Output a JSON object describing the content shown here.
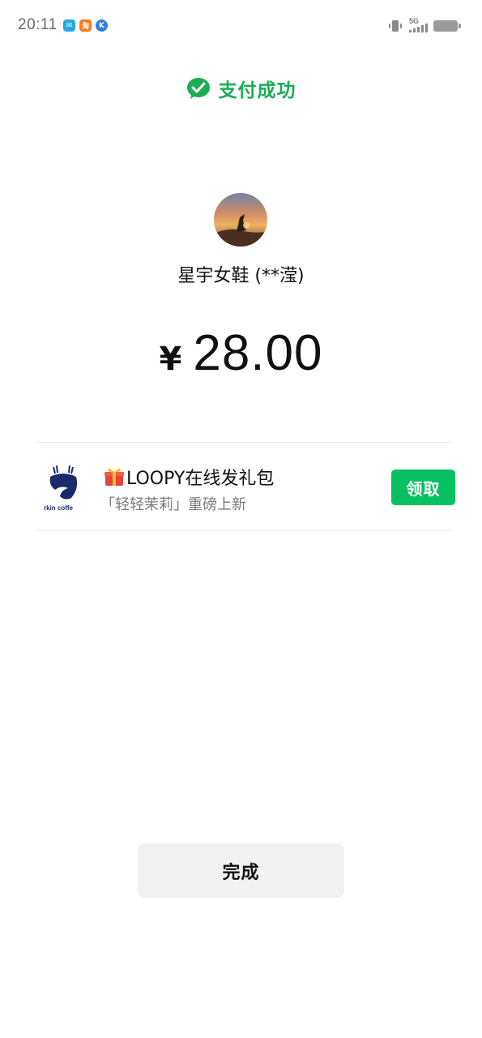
{
  "status_bar": {
    "time": "20:11",
    "network": "5G",
    "notifications": [
      {
        "icon": "message-app-icon",
        "glyph": "✉"
      },
      {
        "icon": "taobao-app-icon",
        "glyph": "淘"
      },
      {
        "icon": "k-app-icon",
        "glyph": "K"
      }
    ]
  },
  "header": {
    "success_text": "支付成功",
    "accent_color": "#1aad52"
  },
  "merchant": {
    "name": "星宇女鞋 (**滢)"
  },
  "payment": {
    "currency_symbol": "¥",
    "amount": "28.00"
  },
  "promo": {
    "title": "LOOPY在线发礼包",
    "subtitle": "「轻轻茉莉」重磅上新",
    "logo_text": "rkin coffe",
    "claim_label": "领取",
    "claim_color": "#07c160"
  },
  "actions": {
    "done_label": "完成"
  }
}
